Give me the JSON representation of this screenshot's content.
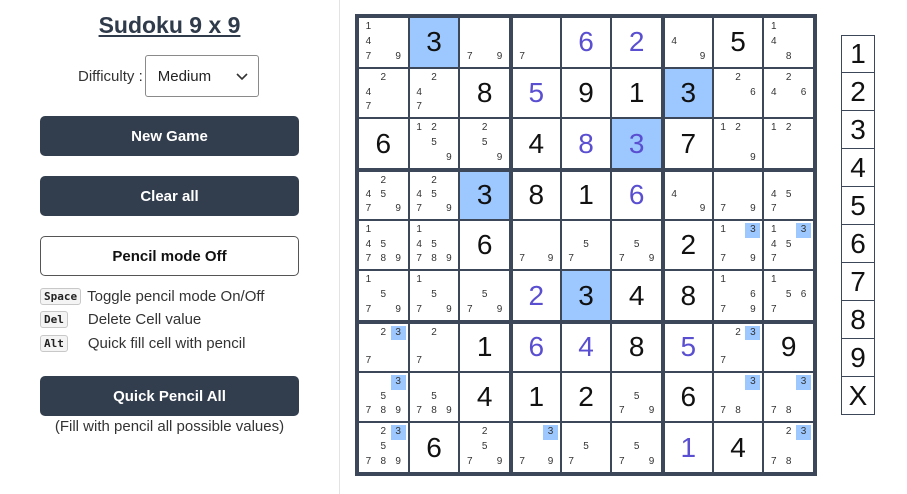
{
  "title": "Sudoku 9 x 9",
  "difficulty": {
    "label": "Difficulty :",
    "value": "Medium"
  },
  "buttons": {
    "new_game": "New Game",
    "clear_all": "Clear all",
    "pencil_mode": "Pencil mode Off",
    "quick_pencil": "Quick Pencil All"
  },
  "shortcuts": [
    {
      "key": "Space",
      "text": "Toggle pencil mode On/Off"
    },
    {
      "key": "Del",
      "text": "Delete Cell value"
    },
    {
      "key": "Alt",
      "text": "Quick fill cell with pencil"
    }
  ],
  "quick_pencil_note": "(Fill with pencil all possible values)",
  "colors": {
    "accent": "#323d4d",
    "selected": "#9cc8ff",
    "user_digit": "#5a4fd0"
  },
  "board": [
    [
      {
        "p": [
          1,
          4,
          7,
          9
        ]
      },
      {
        "v": 3,
        "sel": true
      },
      {
        "p": [
          7,
          9
        ]
      },
      {
        "p": [
          7
        ]
      },
      {
        "v": 6,
        "u": true
      },
      {
        "v": 2,
        "u": true
      },
      {
        "p": [
          4,
          9
        ]
      },
      {
        "v": 5
      },
      {
        "p": [
          1,
          4,
          8
        ]
      }
    ],
    [
      {
        "p": [
          2,
          4,
          7
        ]
      },
      {
        "p": [
          2,
          4,
          7
        ]
      },
      {
        "v": 8
      },
      {
        "v": 5,
        "u": true
      },
      {
        "v": 9
      },
      {
        "v": 1
      },
      {
        "v": 3,
        "sel": true
      },
      {
        "p": [
          2,
          6
        ]
      },
      {
        "p": [
          2,
          4,
          6
        ]
      }
    ],
    [
      {
        "v": 6
      },
      {
        "p": [
          1,
          2,
          5,
          9
        ]
      },
      {
        "p": [
          2,
          5,
          9
        ]
      },
      {
        "v": 4
      },
      {
        "v": 8,
        "u": true
      },
      {
        "v": 3,
        "u": true,
        "sel": true
      },
      {
        "v": 7
      },
      {
        "p": [
          1,
          2,
          9
        ]
      },
      {
        "p": [
          1,
          2
        ]
      }
    ],
    [
      {
        "p": [
          2,
          4,
          5,
          7,
          9
        ]
      },
      {
        "p": [
          2,
          4,
          5,
          7,
          9
        ]
      },
      {
        "v": 3,
        "sel": true
      },
      {
        "v": 8
      },
      {
        "v": 1
      },
      {
        "v": 6,
        "u": true
      },
      {
        "p": [
          4,
          9
        ]
      },
      {
        "p": [
          7,
          9
        ]
      },
      {
        "p": [
          4,
          5,
          7
        ]
      }
    ],
    [
      {
        "p": [
          1,
          4,
          5,
          7,
          8,
          9
        ]
      },
      {
        "p": [
          1,
          4,
          5,
          7,
          8,
          9
        ]
      },
      {
        "v": 6
      },
      {
        "p": [
          7,
          9
        ]
      },
      {
        "p": [
          5,
          7
        ]
      },
      {
        "p": [
          5,
          7,
          9
        ]
      },
      {
        "v": 2
      },
      {
        "p": [
          1,
          3,
          7,
          9
        ],
        "on": [
          3
        ]
      },
      {
        "p": [
          1,
          3,
          4,
          5,
          7
        ],
        "on": [
          3
        ]
      }
    ],
    [
      {
        "p": [
          1,
          5,
          7,
          9
        ]
      },
      {
        "p": [
          1,
          5,
          7,
          9
        ]
      },
      {
        "p": [
          5,
          7,
          9
        ]
      },
      {
        "v": 2,
        "u": true
      },
      {
        "v": 3,
        "sel": true
      },
      {
        "v": 4
      },
      {
        "v": 8
      },
      {
        "p": [
          1,
          6,
          7,
          9
        ]
      },
      {
        "p": [
          1,
          5,
          6,
          7
        ]
      }
    ],
    [
      {
        "p": [
          2,
          3,
          7
        ],
        "on": [
          3
        ]
      },
      {
        "p": [
          2,
          7
        ]
      },
      {
        "v": 1
      },
      {
        "v": 6,
        "u": true
      },
      {
        "v": 4,
        "u": true
      },
      {
        "v": 8
      },
      {
        "v": 5,
        "u": true
      },
      {
        "p": [
          2,
          3,
          7
        ],
        "on": [
          3
        ]
      },
      {
        "v": 9
      }
    ],
    [
      {
        "p": [
          3,
          5,
          7,
          8,
          9
        ],
        "on": [
          3
        ]
      },
      {
        "p": [
          5,
          7,
          8,
          9
        ]
      },
      {
        "v": 4
      },
      {
        "v": 1
      },
      {
        "v": 2
      },
      {
        "p": [
          5,
          7,
          9
        ]
      },
      {
        "v": 6
      },
      {
        "p": [
          3,
          7,
          8
        ],
        "on": [
          3
        ]
      },
      {
        "p": [
          3,
          7,
          8
        ],
        "on": [
          3
        ]
      }
    ],
    [
      {
        "p": [
          2,
          3,
          5,
          7,
          8,
          9
        ],
        "on": [
          3
        ]
      },
      {
        "v": 6
      },
      {
        "p": [
          2,
          5,
          7,
          9
        ]
      },
      {
        "p": [
          3,
          7,
          9
        ],
        "on": [
          3
        ]
      },
      {
        "p": [
          5,
          7
        ]
      },
      {
        "p": [
          5,
          7,
          9
        ]
      },
      {
        "v": 1,
        "u": true
      },
      {
        "v": 4
      },
      {
        "p": [
          2,
          3,
          7,
          8
        ],
        "on": [
          3
        ]
      }
    ]
  ],
  "number_pad": [
    "1",
    "2",
    "3",
    "4",
    "5",
    "6",
    "7",
    "8",
    "9",
    "X"
  ]
}
